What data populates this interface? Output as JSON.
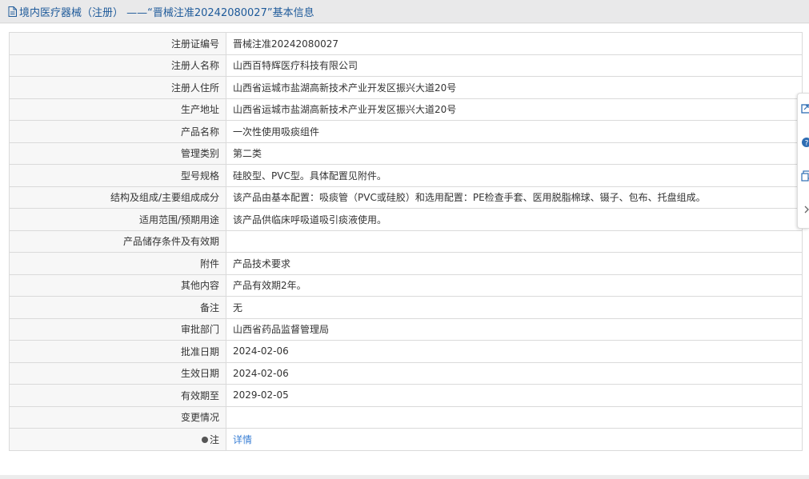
{
  "header": {
    "title": "境内医疗器械（注册） ——“晋械注准20242080027”基本信息",
    "icon": "document-icon"
  },
  "rows": [
    {
      "label": "注册证编号",
      "value": "晋械注准20242080027"
    },
    {
      "label": "注册人名称",
      "value": "山西百特辉医疗科技有限公司"
    },
    {
      "label": "注册人住所",
      "value": "山西省运城市盐湖高新技术产业开发区振兴大道20号"
    },
    {
      "label": "生产地址",
      "value": "山西省运城市盐湖高新技术产业开发区振兴大道20号"
    },
    {
      "label": "产品名称",
      "value": "一次性使用吸痰组件"
    },
    {
      "label": "管理类别",
      "value": "第二类"
    },
    {
      "label": "型号规格",
      "value": "硅胶型、PVC型。具体配置见附件。"
    },
    {
      "label": "结构及组成/主要组成成分",
      "value": "该产品由基本配置：吸痰管（PVC或硅胶）和选用配置：PE检查手套、医用脱脂棉球、镊子、包布、托盘组成。"
    },
    {
      "label": "适用范围/预期用途",
      "value": "该产品供临床呼吸道吸引痰液使用。"
    },
    {
      "label": "产品储存条件及有效期",
      "value": ""
    },
    {
      "label": "附件",
      "value": "产品技术要求"
    },
    {
      "label": "其他内容",
      "value": "产品有效期2年。"
    },
    {
      "label": "备注",
      "value": "无"
    },
    {
      "label": "审批部门",
      "value": "山西省药品监督管理局"
    },
    {
      "label": "批准日期",
      "value": "2024-02-06"
    },
    {
      "label": "生效日期",
      "value": "2024-02-06"
    },
    {
      "label": "有效期至",
      "value": "2029-02-05"
    },
    {
      "label": "变更情况",
      "value": ""
    }
  ],
  "note_row": {
    "label": "注",
    "link": "详情",
    "icon": "lightbulb-icon"
  },
  "side_toolbar": {
    "tools": [
      "share-icon",
      "help-icon",
      "copy-icon",
      "collapse-arrow-icon"
    ]
  },
  "colors": {
    "header_text": "#1e5a9a",
    "link": "#3a7fd5",
    "label_bg": "#f7f7f7",
    "border": "#dadada"
  }
}
